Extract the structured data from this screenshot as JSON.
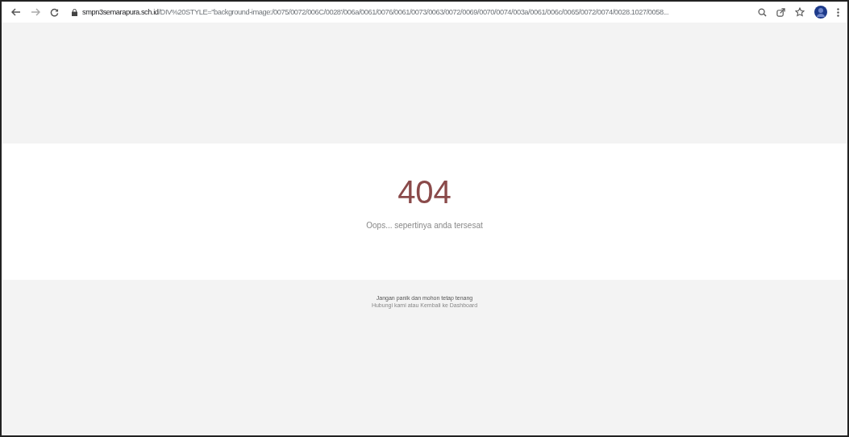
{
  "browser": {
    "url_host": "smpn3semarapura.sch.id",
    "url_path": "/DIV%20STYLE=\"background-image:/0075/0072/006C/0028'/006a/0061/0076/0061/0073/0063/0072/0069/0070/0074/003a/0061/006c/0065/0072/0074/0028.1027/0058..."
  },
  "error": {
    "code": "404",
    "message": "Oops... sepertinya anda tersesat"
  },
  "footer": {
    "line_1": "Jangan panik dan mohon tetap tenang",
    "line_2": "Hubungi kami atau Kembali ke Dashboard"
  }
}
